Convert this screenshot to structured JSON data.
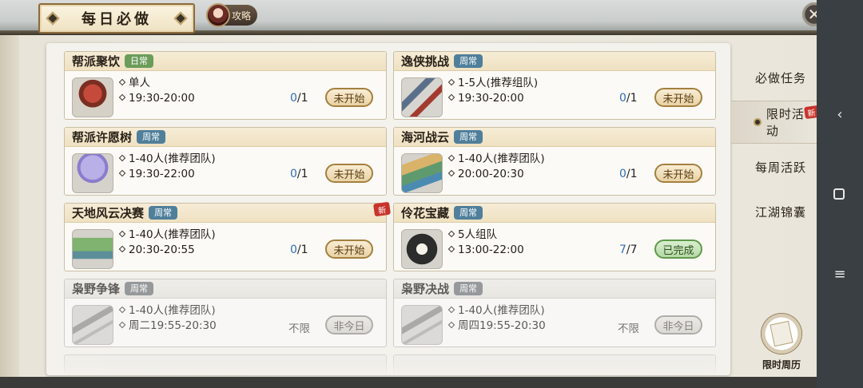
{
  "header": {
    "title": "每日必做",
    "guide_label": "攻略",
    "close_symbol": "✕"
  },
  "nav": {
    "items": [
      {
        "label": "必做任务"
      },
      {
        "label": "限时活动"
      },
      {
        "label": "每周活跃"
      },
      {
        "label": "江湖锦囊"
      }
    ],
    "new_tag": "新",
    "calendar_label": "限时周历"
  },
  "cards": [
    {
      "name": "帮派聚饮",
      "tag": "日常",
      "tag_color": "green",
      "line1": "单人",
      "line2": "19:30-20:00",
      "done": "0",
      "total": "/1",
      "status": "未开始",
      "icon": "bowl-icon"
    },
    {
      "name": "逸侠挑战",
      "tag": "周常",
      "tag_color": "blue",
      "line1": "1-5人(推荐组队)",
      "line2": "19:30-20:00",
      "done": "0",
      "total": "/1",
      "status": "未开始",
      "icon": "scroll-icon"
    },
    {
      "name": "帮派许愿树",
      "tag": "周常",
      "tag_color": "blue",
      "line1": "1-40人(推荐团队)",
      "line2": "19:30-22:00",
      "done": "0",
      "total": "/1",
      "status": "未开始",
      "icon": "wish-tree-icon"
    },
    {
      "name": "海河战云",
      "tag": "周常",
      "tag_color": "blue",
      "line1": "1-40人(推荐团队)",
      "line2": "20:00-20:30",
      "done": "0",
      "total": "/1",
      "status": "未开始",
      "icon": "sand-table-icon"
    },
    {
      "name": "天地风云决赛",
      "tag": "周常",
      "tag_color": "blue",
      "line1": "1-40人(推荐团队)",
      "line2": "20:30-20:55",
      "done": "0",
      "total": "/1",
      "status": "未开始",
      "icon": "mountain-icon"
    },
    {
      "name": "伶花宝藏",
      "tag": "周常",
      "tag_color": "blue",
      "line1": "5人组队",
      "line2": "13:00-22:00",
      "done": "7",
      "total": "/7",
      "status": "已完成",
      "icon": "stone-disc-icon"
    },
    {
      "name": "枭野争锋",
      "tag": "周常",
      "tag_color": "blue",
      "line1": "1-40人(推荐团队)",
      "line2": "周二19:55-20:30",
      "limit": "不限",
      "status": "非今日",
      "icon": "kite-icon"
    },
    {
      "name": "枭野决战",
      "tag": "周常",
      "tag_color": "blue",
      "line1": "1-40人(推荐团队)",
      "line2": "周四19:55-20:30",
      "limit": "不限",
      "status": "非今日",
      "icon": "kite-icon"
    }
  ],
  "colors": {
    "accent_green": "#6b9c5a",
    "accent_blue": "#4f7f9b",
    "progress_blue": "#2f6fb6",
    "new_red": "#c8342c"
  }
}
